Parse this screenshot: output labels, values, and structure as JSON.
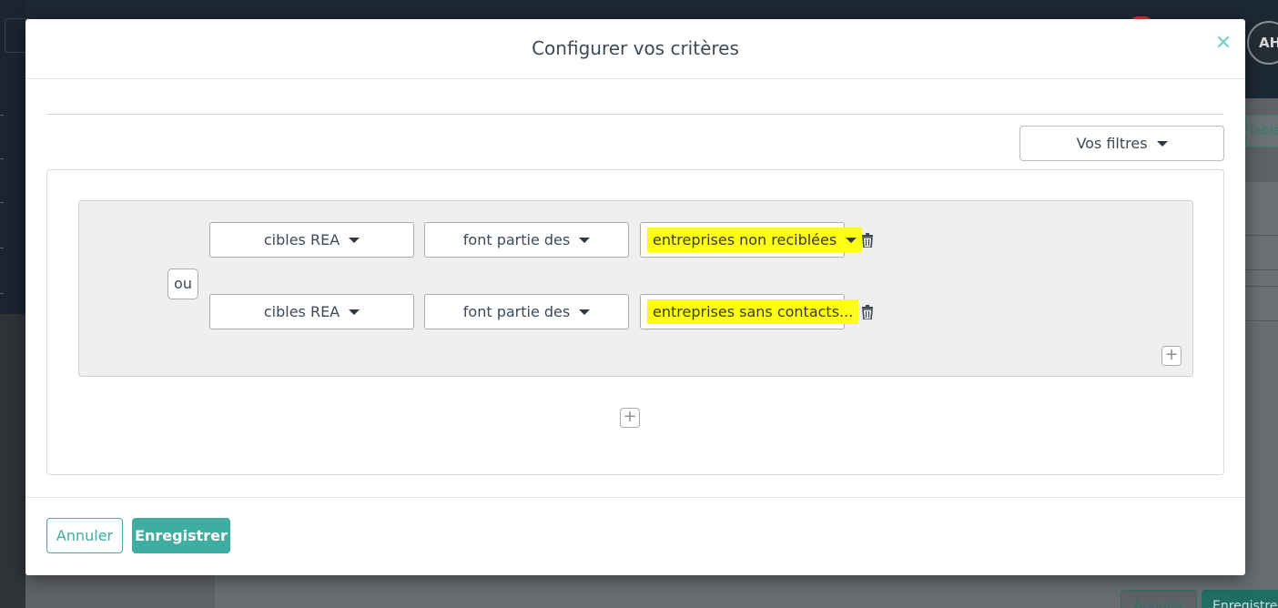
{
  "background": {
    "avatar_initials": "AH",
    "tab_label": "Tableau",
    "annuler_label": "Annuler",
    "enregistrer_label": "Enregistrer"
  },
  "modal": {
    "title": "Configurer vos critères",
    "close_icon": "close-icon",
    "filters_button": "Vos filtres",
    "group_operator": "ou",
    "rules": [
      {
        "field": "cibles REA",
        "operator": "font partie des",
        "value": "entreprises non reciblées",
        "value_highlighted": true
      },
      {
        "field": "cibles REA",
        "operator": "font partie des",
        "value": "entreprises sans contacts...",
        "value_highlighted": true
      }
    ],
    "add_rule_symbol": "+",
    "add_group_symbol": "+",
    "cancel_label": "Annuler",
    "save_label": "Enregistrer"
  },
  "colors": {
    "accent": "#3eaea1",
    "highlight": "#ffff14",
    "text": "#3c4a57"
  }
}
